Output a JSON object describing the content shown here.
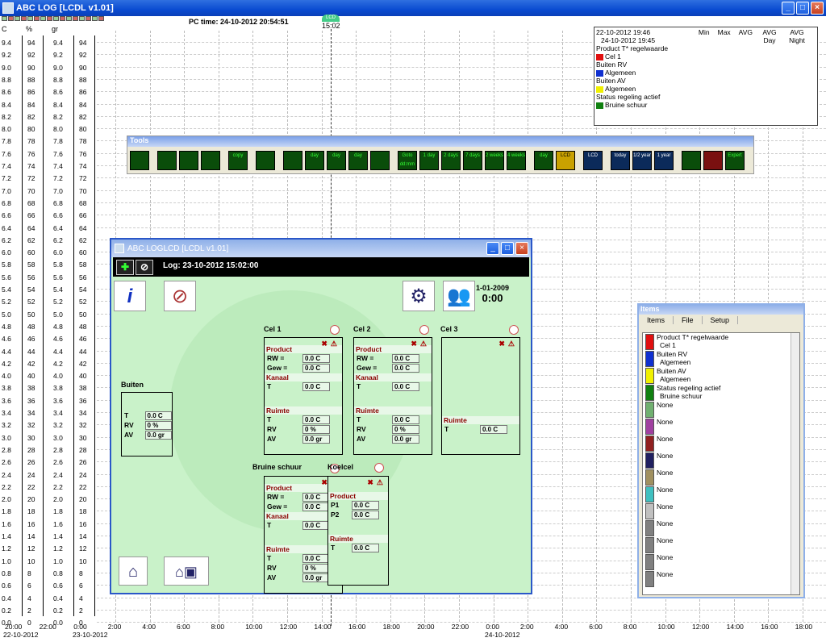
{
  "window": {
    "title": "ABC LOG [LCDL v1.01]"
  },
  "header": {
    "pctime": "PC time: 24-10-2012 20:54:51",
    "cursor_badge": "LCD",
    "cursor_time": "15:02"
  },
  "units": [
    "C",
    "%",
    "gr"
  ],
  "scale_labels": [
    "9.4",
    "9.2",
    "9.0",
    "8.8",
    "8.6",
    "8.4",
    "8.2",
    "8.0",
    "7.8",
    "7.6",
    "7.4",
    "7.2",
    "7.0",
    "6.8",
    "6.6",
    "6.4",
    "6.2",
    "6.0",
    "5.8",
    "5.6",
    "5.4",
    "5.2",
    "5.0",
    "4.8",
    "4.6",
    "4.4",
    "4.2",
    "4.0",
    "3.8",
    "3.6",
    "3.4",
    "3.2",
    "3.0",
    "2.8",
    "2.6",
    "2.4",
    "2.2",
    "2.0",
    "1.8",
    "1.6",
    "1.4",
    "1.2",
    "1.0",
    "0.8",
    "0.6",
    "0.4",
    "0.2",
    "0.0"
  ],
  "scale_labels_pct": [
    "94",
    "92",
    "90",
    "88",
    "86",
    "84",
    "82",
    "80",
    "78",
    "76",
    "74",
    "72",
    "70",
    "68",
    "66",
    "64",
    "62",
    "60",
    "58",
    "56",
    "54",
    "52",
    "50",
    "48",
    "46",
    "44",
    "42",
    "40",
    "38",
    "36",
    "34",
    "32",
    "30",
    "28",
    "26",
    "24",
    "22",
    "20",
    "18",
    "16",
    "14",
    "12",
    "10",
    "8",
    "6",
    "4",
    "2",
    "0"
  ],
  "xaxis": {
    "ticks": [
      "20:00",
      "22:00",
      "0:00",
      "2:00",
      "4:00",
      "6:00",
      "8:00",
      "10:00",
      "12:00",
      "14:00",
      "16:00",
      "18:00",
      "20:00",
      "22:00",
      "0:00",
      "2:00",
      "4:00",
      "6:00",
      "8:00",
      "10:00",
      "12:00",
      "14:00",
      "16:00",
      "18:00"
    ],
    "dates": [
      "22-10-2012",
      "23-10-2012",
      "24-10-2012"
    ]
  },
  "legend": {
    "from": "22-10-2012 19:46",
    "to": "24-10-2012 19:45",
    "cols": [
      "Min",
      "Max",
      "AVG",
      "AVG Day",
      "AVG Night"
    ],
    "entries": [
      {
        "title": "Product T* regelwaarde",
        "name": "Cel 1",
        "color": "#e01010"
      },
      {
        "title": "Buiten RV",
        "name": "Algemeen",
        "color": "#1030d0"
      },
      {
        "title": "Buiten AV",
        "name": "Algemeen",
        "color": "#f0f000"
      },
      {
        "title": "Status regeling actief",
        "name": "Bruine schuur",
        "color": "#108010"
      }
    ]
  },
  "tools": {
    "title": "Tools",
    "buttons": [
      "",
      "",
      "",
      "",
      "copy",
      "",
      "",
      "day",
      "day",
      "day",
      "",
      "Goto dd:mm",
      "1 day",
      "2 days",
      "7 days",
      "2 weeks",
      "4 weeks",
      "day",
      "LCD",
      "LCD",
      "today",
      "1/2 year",
      "1 year",
      "",
      "",
      "Expert"
    ]
  },
  "lcd": {
    "title": "ABC LOGLCD [LCDL v1.01]",
    "log": "Log: 23-10-2012 15:02:00",
    "date": "1-01-2009",
    "time": "0:00",
    "buiten": {
      "label": "Buiten",
      "rows": [
        {
          "k": "T",
          "v": "0.0 C"
        },
        {
          "k": "RV",
          "v": "0 %"
        },
        {
          "k": "AV",
          "v": "0.0 gr"
        }
      ]
    },
    "cel1": {
      "label": "Cel 1",
      "rw": "0.0 C",
      "gew": "0.0 C",
      "kt": "0.0 C",
      "rt": "0.0 C",
      "rrv": "0 %",
      "rav": "0.0 gr"
    },
    "cel2": {
      "label": "Cel 2",
      "rw": "0.0 C",
      "gew": "0.0 C",
      "kt": "0.0 C",
      "rt": "0.0 C",
      "rrv": "0 %",
      "rav": "0.0 gr"
    },
    "cel3": {
      "label": "Cel 3",
      "rt": "0.0 C"
    },
    "bruine": {
      "label": "Bruine schuur",
      "rw": "0.0 C",
      "gew": "0.0 C",
      "kt": "0.0 C",
      "rt": "0.0 C",
      "rrv": "0 %",
      "rav": "0.0 gr"
    },
    "koelcel": {
      "label": "Koelcel",
      "p1": "0.0 C",
      "p2": "0.0 C",
      "rt": "0.0 C"
    },
    "labels": {
      "product": "Product",
      "kanaal": "Kanaal",
      "ruimte": "Ruimte",
      "rw": "RW =",
      "gew": "Gew =",
      "t": "T",
      "rv": "RV",
      "av": "AV",
      "p1": "P1",
      "p2": "P2"
    }
  },
  "items": {
    "title": "Items",
    "menu": [
      "Items",
      "File",
      "Setup"
    ],
    "list": [
      {
        "label": "Product T* regelwaarde",
        "sub": "Cel 1",
        "color": "#e01010"
      },
      {
        "label": "Buiten RV",
        "sub": "Algemeen",
        "color": "#1030d0"
      },
      {
        "label": "Buiten AV",
        "sub": "Algemeen",
        "color": "#f0f000"
      },
      {
        "label": "Status regeling actief",
        "sub": "Bruine schuur",
        "color": "#108010"
      },
      {
        "label": "None",
        "sub": "",
        "color": "#70b070"
      },
      {
        "label": "None",
        "sub": "",
        "color": "#a040a0"
      },
      {
        "label": "None",
        "sub": "",
        "color": "#902020"
      },
      {
        "label": "None",
        "sub": "",
        "color": "#202060"
      },
      {
        "label": "None",
        "sub": "",
        "color": "#a09060"
      },
      {
        "label": "None",
        "sub": "",
        "color": "#40c0c0"
      },
      {
        "label": "None",
        "sub": "",
        "color": "#c0c0c0"
      },
      {
        "label": "None",
        "sub": "",
        "color": "#808080"
      },
      {
        "label": "None",
        "sub": "",
        "color": "#808080"
      },
      {
        "label": "None",
        "sub": "",
        "color": "#808080"
      },
      {
        "label": "None",
        "sub": "",
        "color": "#808080"
      }
    ]
  }
}
